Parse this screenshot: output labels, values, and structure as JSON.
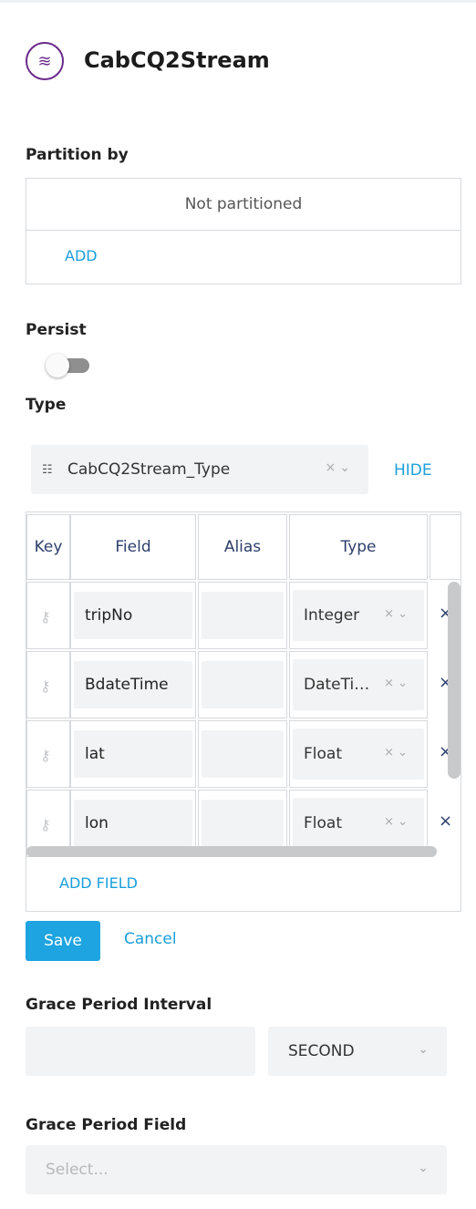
{
  "header": {
    "icon": "stream-icon",
    "title": "CabCQ2Stream"
  },
  "partition": {
    "label": "Partition by",
    "empty_text": "Not partitioned",
    "add_label": "ADD"
  },
  "persist": {
    "label": "Persist",
    "enabled": false
  },
  "type": {
    "label": "Type",
    "selected": "CabCQ2Stream_Type",
    "hide_label": "HIDE",
    "table": {
      "headers": [
        "Key",
        "Field",
        "Alias",
        "Type"
      ],
      "rows": [
        {
          "field": "tripNo",
          "alias": "",
          "type": "Integer"
        },
        {
          "field": "BdateTime",
          "alias": "",
          "type": "DateTi…"
        },
        {
          "field": "lat",
          "alias": "",
          "type": "Float"
        },
        {
          "field": "lon",
          "alias": "",
          "type": "Float"
        }
      ],
      "add_field_label": "ADD FIELD"
    },
    "save_label": "Save",
    "cancel_label": "Cancel"
  },
  "grace_interval": {
    "label": "Grace Period Interval",
    "value": "",
    "unit": "SECOND"
  },
  "grace_field": {
    "label": "Grace Period Field",
    "placeholder": "Select..."
  },
  "colors": {
    "accent": "#1ea4e0",
    "icon_purple": "#6a2a8c",
    "header_text": "#2c3e6b"
  }
}
